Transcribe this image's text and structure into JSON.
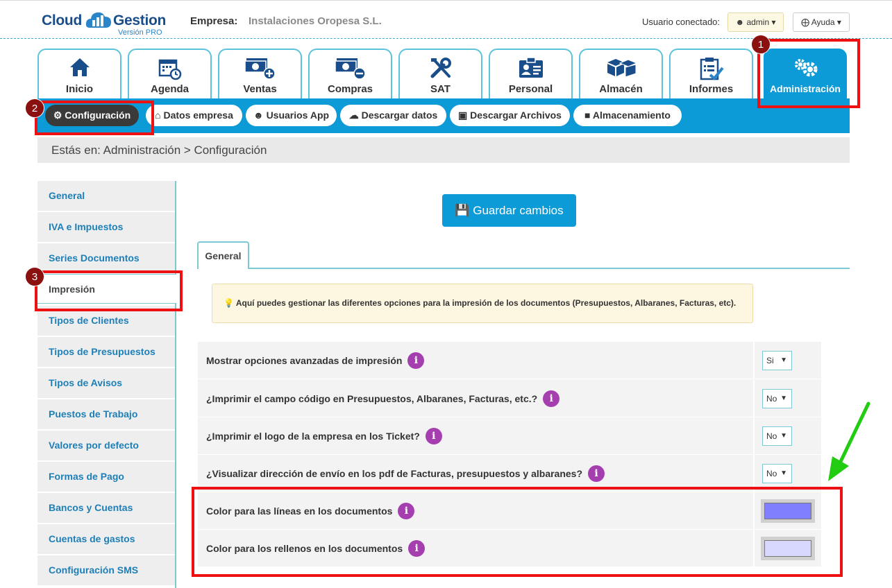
{
  "header": {
    "logo_part1": "Cloud",
    "logo_part2": "Gestion",
    "logo_sub": "Versión PRO",
    "empresa_label": "Empresa:",
    "empresa_value": "Instalaciones Oropesa S.L.",
    "user_label": "Usuario conectado:",
    "user_button": "admin",
    "help_button": "Ayuda"
  },
  "tabs": [
    {
      "label": "Inicio",
      "icon": "home-icon"
    },
    {
      "label": "Agenda",
      "icon": "calendar-icon"
    },
    {
      "label": "Ventas",
      "icon": "money-plus-icon"
    },
    {
      "label": "Compras",
      "icon": "money-minus-icon"
    },
    {
      "label": "SAT",
      "icon": "tools-icon"
    },
    {
      "label": "Personal",
      "icon": "id-card-icon"
    },
    {
      "label": "Almacén",
      "icon": "boxes-icon"
    },
    {
      "label": "Informes",
      "icon": "clipboard-check-icon"
    },
    {
      "label": "Administración",
      "icon": "gears-icon",
      "active": true
    }
  ],
  "subnav": [
    {
      "label": "Configuración",
      "active": true
    },
    {
      "label": "Datos empresa"
    },
    {
      "label": "Usuarios App"
    },
    {
      "label": "Descargar datos"
    },
    {
      "label": "Descargar Archivos"
    },
    {
      "label": "Almacenamiento"
    }
  ],
  "breadcrumb": "Estás en: Administración > Configuración",
  "sidebar": [
    "General",
    "IVA e Impuestos",
    "Series Documentos",
    "Impresión",
    "Tipos de Clientes",
    "Tipos de Presupuestos",
    "Tipos de Avisos",
    "Puestos de Trabajo",
    "Valores por defecto",
    "Formas de Pago",
    "Bancos y Cuentas",
    "Cuentas de gastos",
    "Configuración SMS"
  ],
  "sidebar_active": "Impresión",
  "save_button": "Guardar cambios",
  "content_tab": "General",
  "tip": "Aquí puedes gestionar las diferentes opciones para la impresión de los documentos (Presupuestos, Albaranes, Facturas, etc).",
  "settings": [
    {
      "label": "Mostrar opciones avanzadas de impresión",
      "type": "select",
      "value": "Si"
    },
    {
      "label": "¿Imprimir el campo código en Presupuestos, Albaranes, Facturas, etc.?",
      "type": "select",
      "value": "No"
    },
    {
      "label": "¿Imprimir el logo de la empresa en los Ticket?",
      "type": "select",
      "value": "No"
    },
    {
      "label": "¿Visualizar dirección de envío en los pdf de Facturas, presupuestos y albaranes?",
      "type": "select",
      "value": "No"
    },
    {
      "label": "Color para las líneas en los documentos",
      "type": "color",
      "value": "#8080ff"
    },
    {
      "label": "Color para los rellenos en los documentos",
      "type": "color",
      "value": "#d8d8ff"
    }
  ],
  "annotations": {
    "badge1": "1",
    "badge2": "2",
    "badge3": "3"
  },
  "colors": {
    "accent": "#0d9bd7",
    "highlight": "#ee1111",
    "arrow": "#22cc11",
    "info": "#a53fb0"
  }
}
